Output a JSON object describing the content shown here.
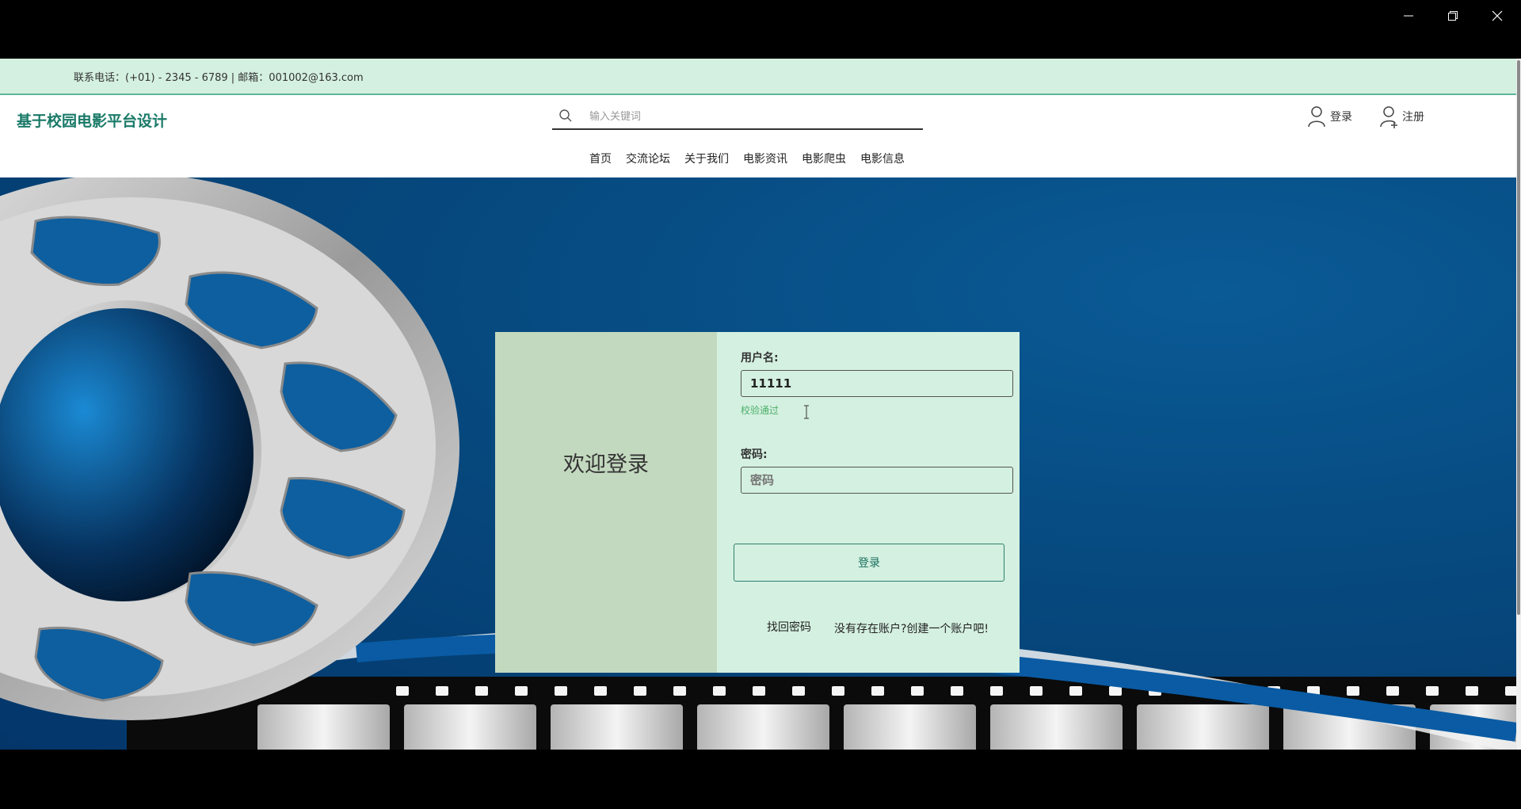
{
  "window": {
    "controls": [
      "minimize-icon",
      "restore-icon",
      "close-icon"
    ]
  },
  "topbar": {
    "contact": "联系电话：(+01) - 2345 - 6789 | 邮箱：001002@163.com"
  },
  "header": {
    "logo": "基于校园电影平台设计",
    "search": {
      "placeholder": "输入关键词",
      "value": ""
    },
    "login_label": "登录",
    "register_label": "注册",
    "nav": [
      "首页",
      "交流论坛",
      "关于我们",
      "电影资讯",
      "电影爬虫",
      "电影信息"
    ]
  },
  "login_card": {
    "welcome": "欢迎登录",
    "username_label": "用户名:",
    "username_value": "11111",
    "validation_msg": "校验通过",
    "password_label": "密码:",
    "password_placeholder": "密码",
    "submit_label": "登录",
    "forgot_link": "找回密码",
    "register_link": "没有存在账户?创建一个账户吧!"
  },
  "colors": {
    "topbar_bg": "#d4f0e0",
    "brand": "#1a7a68",
    "card_left": "#c3d9bf",
    "card_right": "#d4f0e0",
    "valid_text": "#4caf6a",
    "banner_blue": "#06497e"
  }
}
